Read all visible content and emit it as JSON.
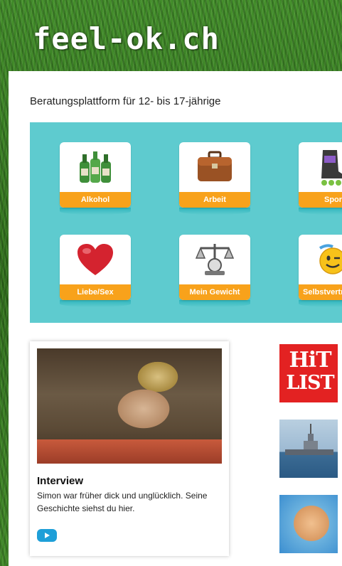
{
  "header": {
    "logo": "feel-ok.ch"
  },
  "main": {
    "tagline": "Beratungsplattform für 12- bis 17-jährige",
    "topics": [
      {
        "label": "Alkohol",
        "icon": "bottles-icon"
      },
      {
        "label": "Arbeit",
        "icon": "briefcase-icon"
      },
      {
        "label": "Sport",
        "icon": "inline-skate-icon"
      },
      {
        "label": "Liebe/Sex",
        "icon": "heart-icon"
      },
      {
        "label": "Mein Gewicht",
        "icon": "scale-icon"
      },
      {
        "label": "Selbstvertrauen",
        "icon": "smiley-icon"
      }
    ]
  },
  "feature": {
    "title": "Interview",
    "description": "Simon war früher dick und unglücklich. Seine Geschichte siehst du hier.",
    "play_icon": "play-icon"
  },
  "sidebar": {
    "hitlist_line1": "HiT",
    "hitlist_line2": "LIST",
    "thumbs": [
      "hitlist-thumb",
      "ship-thumb",
      "hands-thumb"
    ]
  },
  "colors": {
    "panel": "#5ecbcf",
    "tile_label": "#f8a21b",
    "play_button": "#1e9fd8",
    "hitlist": "#e32222"
  }
}
